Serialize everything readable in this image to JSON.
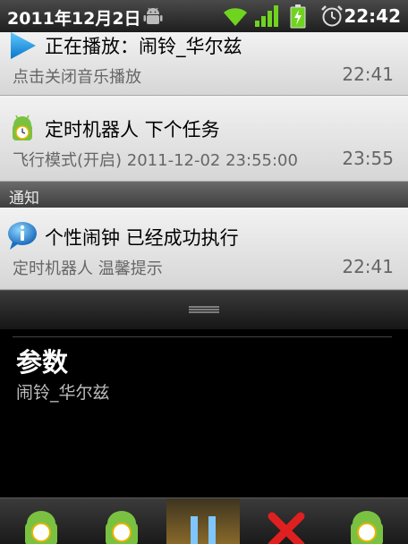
{
  "status_bar": {
    "date": "2011年12月2日",
    "time": "22:42"
  },
  "notifications": [
    {
      "title": "正在播放：闹铃_华尔兹",
      "subtitle": "点击关闭音乐播放",
      "time": "22:41",
      "icon": "play-icon"
    },
    {
      "title": "定时机器人 下个任务",
      "subtitle": "飞行模式(开启) 2011-12-02 23:55:00",
      "time": "23:55",
      "icon": "robot-clock-icon"
    }
  ],
  "section": {
    "label": "通知"
  },
  "notice": {
    "title": "个性闹钟 已经成功执行",
    "subtitle": "定时机器人 温馨提示",
    "time": "22:41",
    "icon": "info-bubble-icon"
  },
  "detail": {
    "title": "参数",
    "value": "闹铃_华尔兹"
  },
  "colors": {
    "accent_green": "#7ac142",
    "status_bar_icon_green": "#6fd31f",
    "close_red": "#e02020"
  }
}
